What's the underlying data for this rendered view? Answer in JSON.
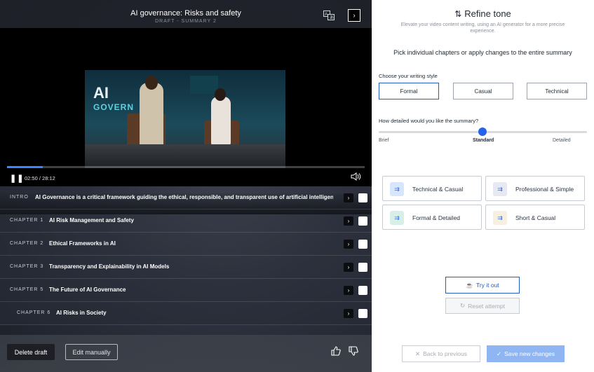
{
  "header": {
    "title": "AI governance: Risks and safety",
    "subtitle": "DRAFT - SUMMARY 2",
    "translate_icon": "translate-icon",
    "collapse_icon": "collapse-panel-icon"
  },
  "video": {
    "scene_logo": "AI",
    "scene_logo_sub": "GOVERN",
    "time": "02:50 / 28:12",
    "progress_fraction": 0.1
  },
  "chapters": [
    {
      "tag": "INTRO",
      "name": "AI Governance is a critical framework guiding the ethical, responsible, and transparent use of artificial intelligence..."
    },
    {
      "tag": "CHAPTER 1",
      "name": "AI Risk Management and Safety"
    },
    {
      "tag": "CHAPTER 2",
      "name": "Ethical Frameworks in AI"
    },
    {
      "tag": "CHAPTER 3",
      "name": "Transparency and Explainability in AI Models"
    },
    {
      "tag": "CHAPTER 5",
      "name": "The Future of AI Governance"
    },
    {
      "tag": "CHAPTER 6",
      "name": "AI Risks in Society"
    }
  ],
  "footer": {
    "delete_label": "Delete draft",
    "edit_label": "Edit manually"
  },
  "panel": {
    "title": "Refine tone",
    "description": "Elevate your video content writing, using an AI generator for a more precise experience.",
    "pick_text": "Pick individual chapters or apply changes to the entire summary",
    "style_label": "Choose your writing style",
    "styles": [
      "Formal",
      "Casual",
      "Technical"
    ],
    "selected_style": "Formal",
    "detail_label": "How detailed would you like the summary?",
    "detail_levels": [
      "Brief",
      "Standard",
      "Detailed"
    ],
    "detail_value": "Standard",
    "combos": [
      "Technical & Casual",
      "Professional & Simple",
      "Formal & Detailed",
      "Short & Casual"
    ],
    "try_label": "Try it out",
    "reset_label": "Reset attempt",
    "back_label": "Back to previous",
    "save_label": "Save new changes"
  },
  "colors": {
    "accent": "#1f5fbf",
    "knob": "#2563eb",
    "save_bg": "#8fb6f2"
  }
}
